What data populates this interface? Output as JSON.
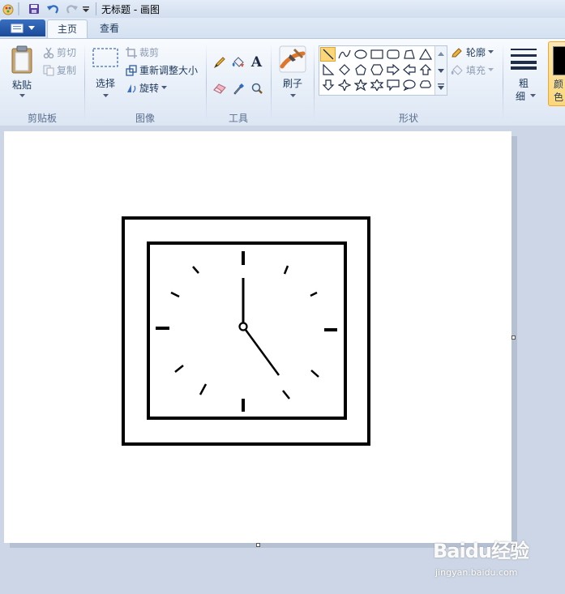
{
  "window": {
    "title": "无标题 - 画图"
  },
  "tabs": [
    {
      "label": "主页"
    },
    {
      "label": "查看"
    }
  ],
  "clipboard": {
    "paste_label": "粘贴",
    "cut_label": "剪切",
    "copy_label": "复制",
    "group_label": "剪贴板"
  },
  "image": {
    "select_label": "选择",
    "crop_label": "裁剪",
    "resize_label": "重新调整大小",
    "rotate_label": "旋转",
    "group_label": "图像"
  },
  "tools": {
    "group_label": "工具",
    "text_tool_glyph": "A"
  },
  "brushes": {
    "label": "刷子"
  },
  "shapes": {
    "group_label": "形状",
    "outline_label": "轮廓",
    "fill_label": "填充"
  },
  "size": {
    "label_line1": "粗",
    "label_line2": "细"
  },
  "colors": {
    "label_partial_1": "颜",
    "label_partial_2": "色",
    "current_color": "#000000",
    "accent": "#f5a623"
  },
  "watermark": {
    "logo": "Baidu经验",
    "url": "jingyan.baidu.com"
  }
}
